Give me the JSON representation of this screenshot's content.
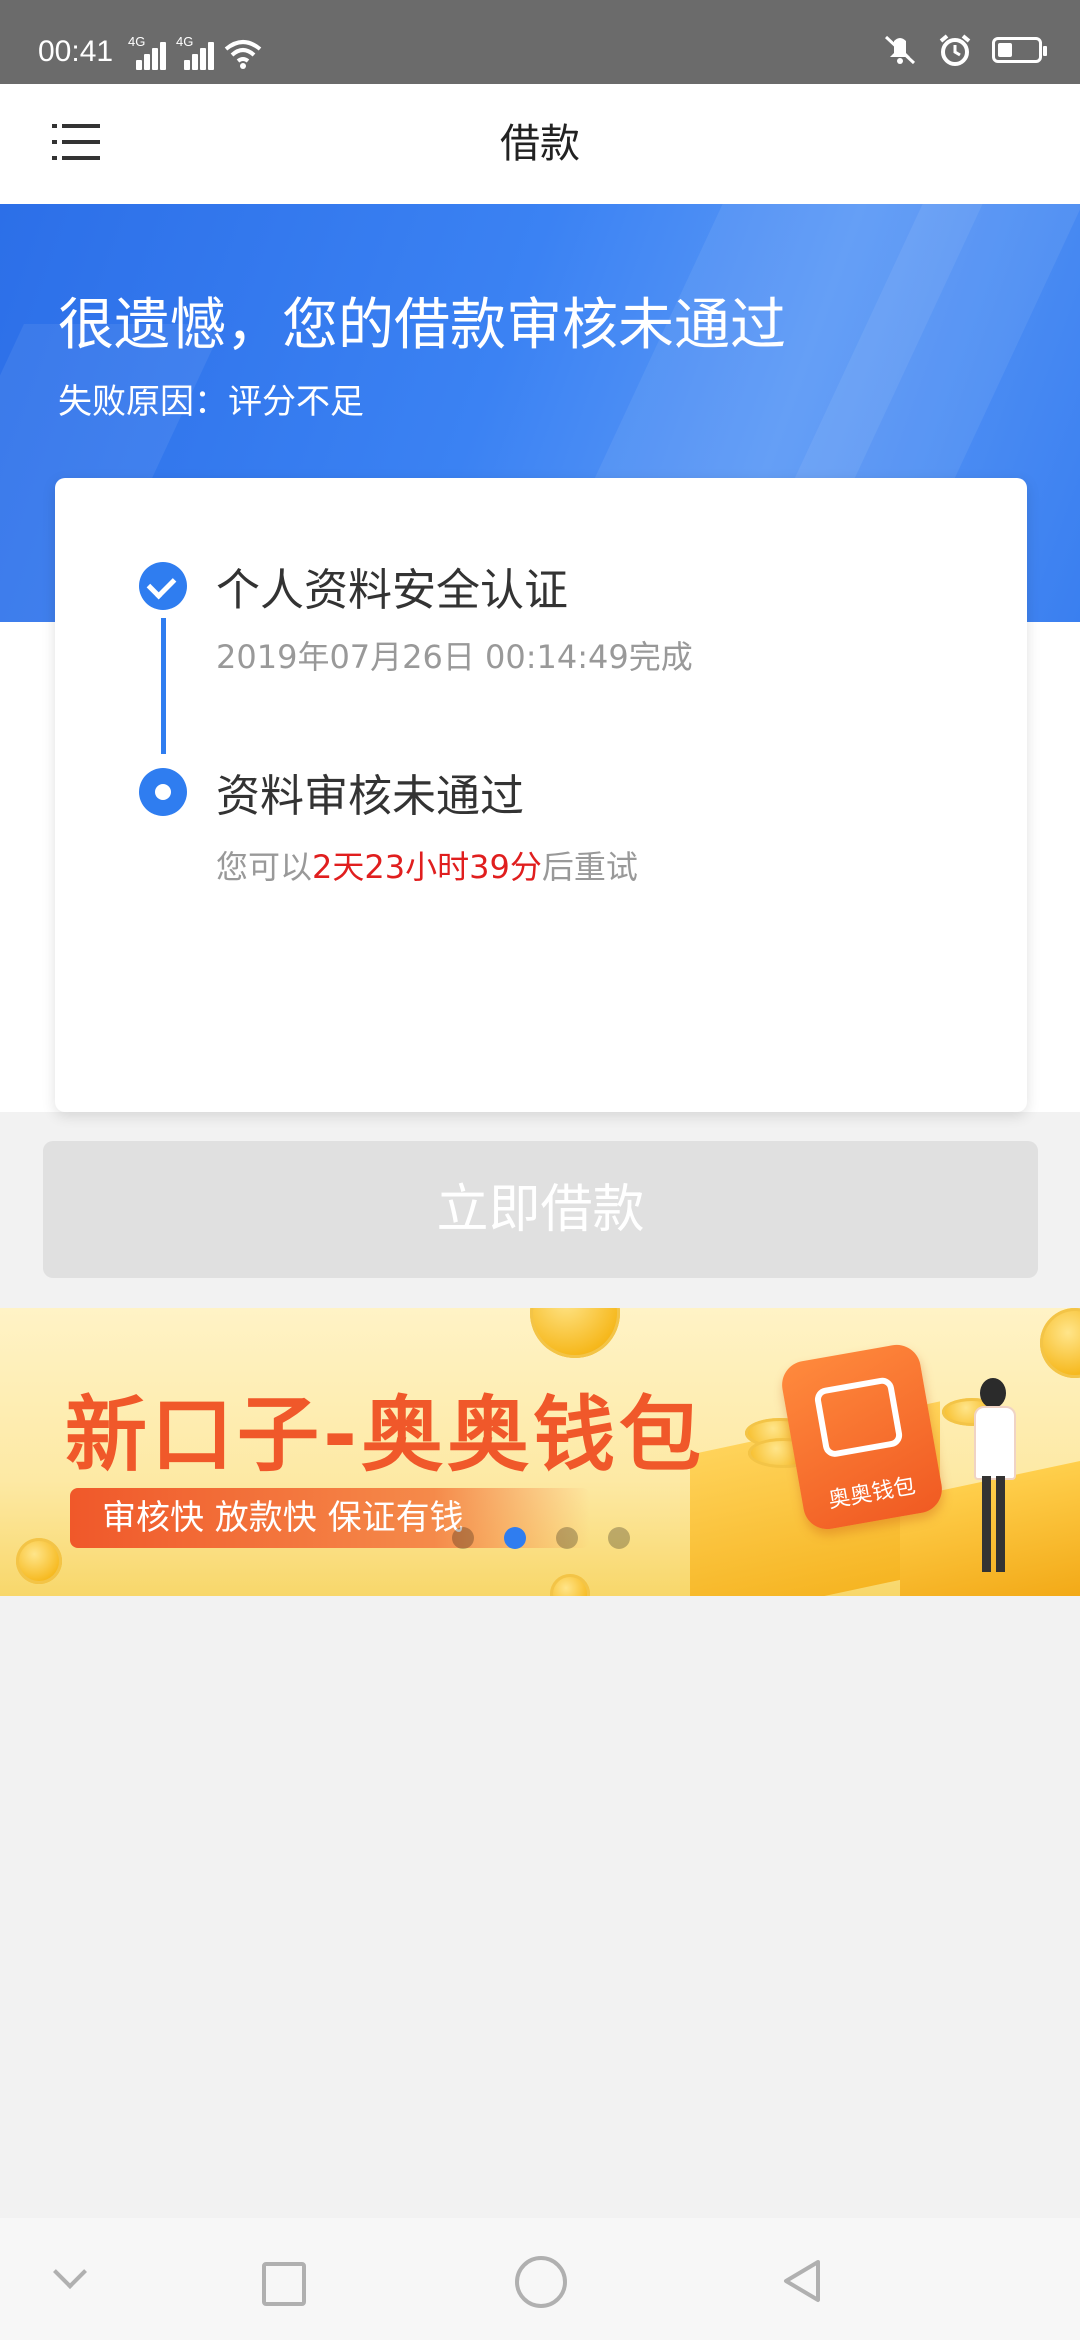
{
  "status_bar": {
    "time": "00:41",
    "network_labels": [
      "4G",
      "4G"
    ],
    "icons": [
      "signal-icon",
      "signal-icon",
      "wifi-icon",
      "mute-vibrate-icon",
      "alarm-icon",
      "battery-icon"
    ]
  },
  "app_bar": {
    "title": "借款",
    "menu_icon": "menu-icon"
  },
  "hero": {
    "title": "很遗憾，您的借款审核未通过",
    "reason": "失败原因：评分不足"
  },
  "steps": [
    {
      "title": "个人资料安全认证",
      "description": "2019年07月26日 00:14:49完成",
      "icon": "check-circle-icon"
    },
    {
      "title": "资料审核未通过",
      "description_prefix": "您可以",
      "description_highlight": "2天23小时39分",
      "description_suffix": "后重试",
      "icon": "current-step-icon"
    }
  ],
  "colors": {
    "primary": "#2f7df0",
    "highlight": "#e01e1e",
    "button_disabled": "#e0e0e0",
    "banner_title": "#f0582a"
  },
  "borrow_button": {
    "label": "立即借款",
    "state": "disabled"
  },
  "banner": {
    "title": "新口子-奥奥钱包",
    "tagline": "审核快  放款快  保证有钱",
    "app_icon_label": "奥奥钱包",
    "carousel_count": 4,
    "carousel_active_index": 1
  },
  "nav_bar": {
    "icons": [
      "hide-nav-icon",
      "recents-icon",
      "home-icon",
      "back-icon"
    ]
  }
}
